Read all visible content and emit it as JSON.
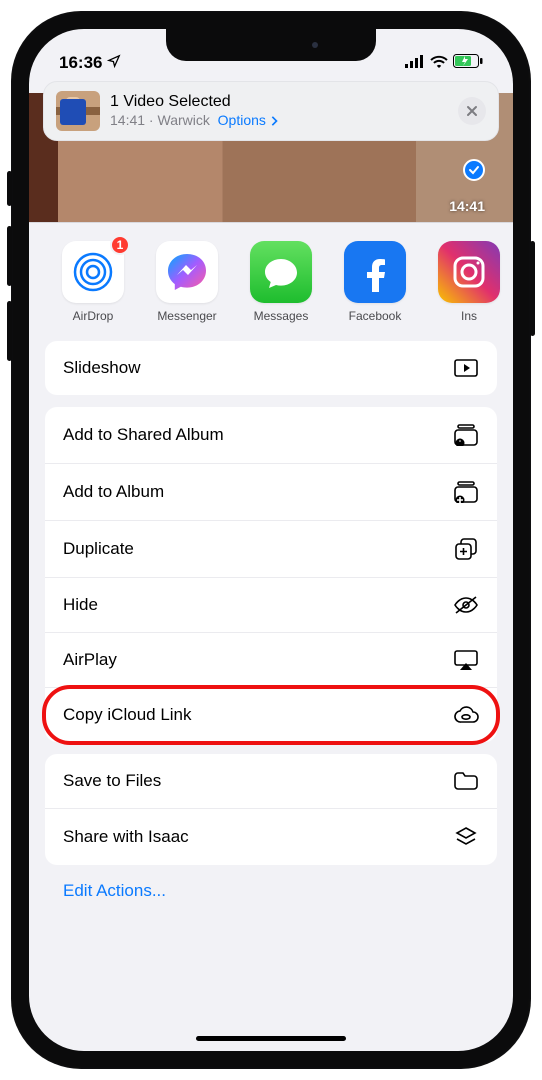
{
  "status": {
    "time": "16:36"
  },
  "header": {
    "title": "1 Video Selected",
    "subtitle_time": "14:41",
    "subtitle_location": "Warwick",
    "options_label": "Options"
  },
  "preview": {
    "duration": "14:41"
  },
  "apps": [
    {
      "id": "airdrop",
      "label": "AirDrop",
      "badge": "1"
    },
    {
      "id": "messenger",
      "label": "Messenger"
    },
    {
      "id": "messages",
      "label": "Messages"
    },
    {
      "id": "facebook",
      "label": "Facebook"
    },
    {
      "id": "instagram",
      "label": "Ins"
    }
  ],
  "groups": [
    {
      "rows": [
        {
          "id": "slideshow",
          "label": "Slideshow",
          "icon": "play-rect"
        }
      ]
    },
    {
      "rows": [
        {
          "id": "add-shared-album",
          "label": "Add to Shared Album",
          "icon": "album-person"
        },
        {
          "id": "add-album",
          "label": "Add to Album",
          "icon": "album-plus"
        },
        {
          "id": "duplicate",
          "label": "Duplicate",
          "icon": "doc-plus"
        },
        {
          "id": "hide",
          "label": "Hide",
          "icon": "eye-slash"
        },
        {
          "id": "airplay",
          "label": "AirPlay",
          "icon": "airplay"
        },
        {
          "id": "copy-icloud",
          "label": "Copy iCloud Link",
          "icon": "cloud-link",
          "highlighted": true
        }
      ]
    },
    {
      "rows": [
        {
          "id": "save-to-files",
          "label": "Save to Files",
          "icon": "folder"
        },
        {
          "id": "share-isaac",
          "label": "Share with Isaac",
          "icon": "layers"
        }
      ]
    }
  ],
  "edit_actions_label": "Edit Actions..."
}
